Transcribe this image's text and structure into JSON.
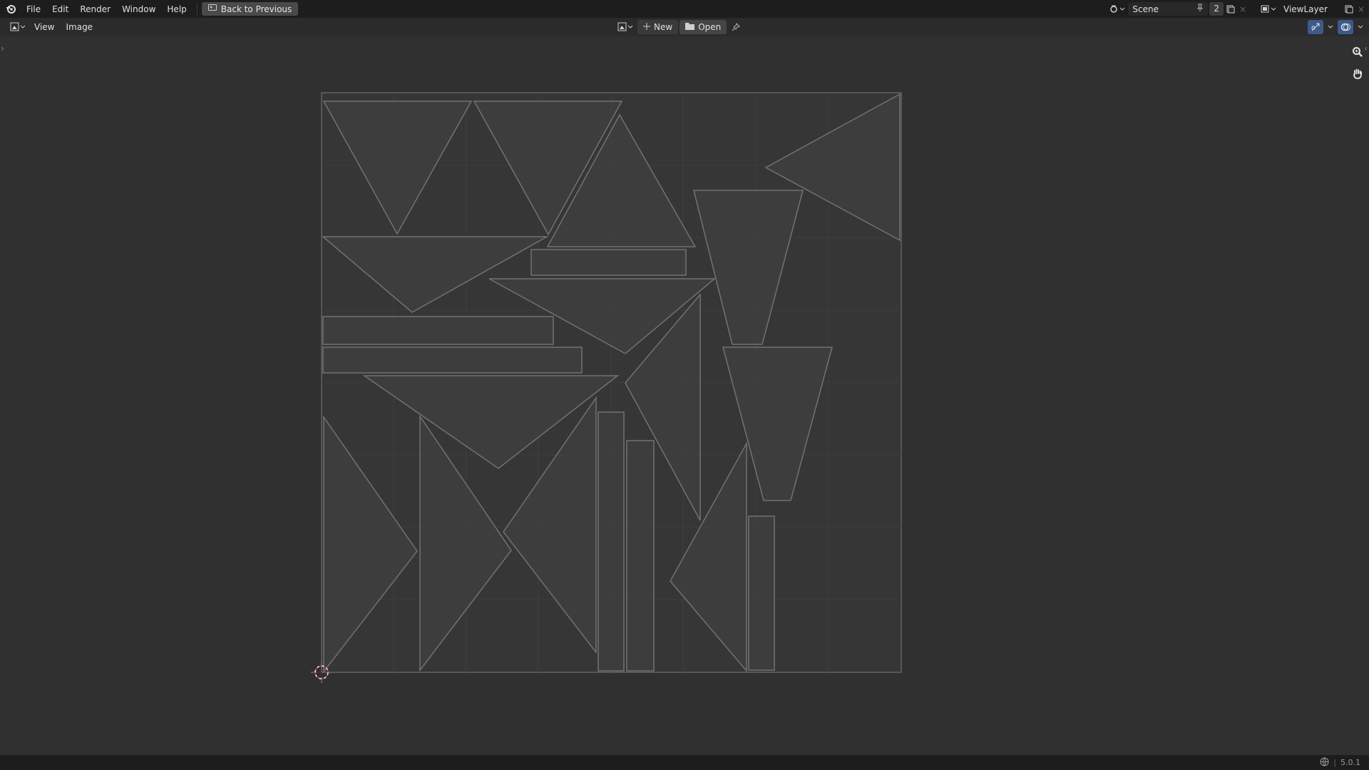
{
  "app": {
    "version": "5.0.1"
  },
  "topbar": {
    "menus": [
      "File",
      "Edit",
      "Render",
      "Window",
      "Help"
    ],
    "back_label": "Back to Previous",
    "scene_name": "Scene",
    "scene_count": "2",
    "view_layer": "ViewLayer"
  },
  "editor_header": {
    "menus": [
      "View",
      "Image"
    ],
    "new_label": "New",
    "open_label": "Open"
  },
  "colors": {
    "accent": "#3d5a8a",
    "uv_edge": "#6e6e6e",
    "uv_face": "#3d3d3d",
    "grid": "#3a3a3a"
  },
  "icons": {
    "logo": "blender-logo-icon",
    "back": "back-to-previous-icon",
    "scene": "scene-icon",
    "pin": "pin-icon",
    "new_scene": "new-scene-icon",
    "view_layer": "view-layer-icon",
    "editor_type": "image-editor-icon",
    "new": "plus-icon",
    "open": "folder-icon",
    "zoom": "zoom-icon",
    "pan": "hand-icon",
    "overlay": "overlay-icon",
    "gizmo": "gizmo-icon",
    "cursor": "2d-cursor-icon",
    "status_globe": "globe-icon"
  }
}
